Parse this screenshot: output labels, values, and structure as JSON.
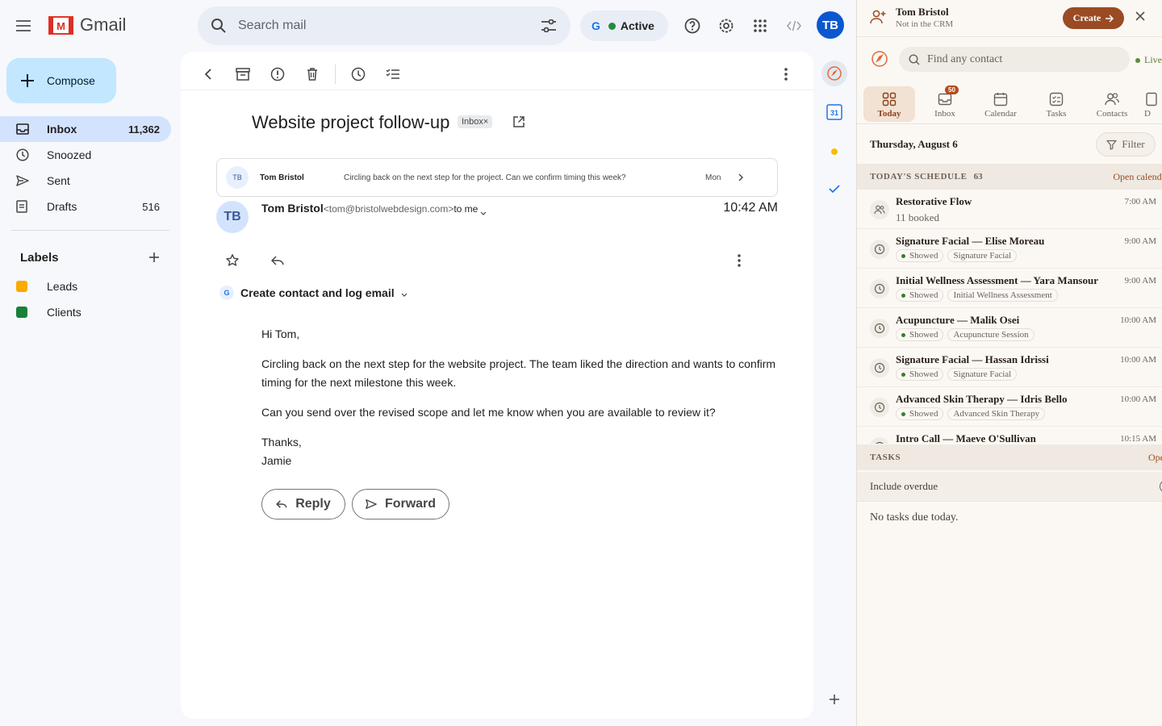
{
  "app": {
    "name": "Gmail"
  },
  "search": {
    "placeholder": "Search mail"
  },
  "status": {
    "g": "G",
    "label": "Active"
  },
  "account": {
    "initials": "TB"
  },
  "compose": {
    "label": "Compose"
  },
  "nav": [
    {
      "label": "Inbox",
      "count": "11,362",
      "icon": "inbox-icon"
    },
    {
      "label": "Snoozed",
      "count": "",
      "icon": "clock-icon"
    },
    {
      "label": "Sent",
      "count": "",
      "icon": "send-icon"
    },
    {
      "label": "Drafts",
      "count": "516",
      "icon": "draft-icon"
    }
  ],
  "labels": {
    "title": "Labels",
    "items": [
      {
        "name": "Leads",
        "color": "#f9ab00"
      },
      {
        "name": "Clients",
        "color": "#188038"
      }
    ]
  },
  "email": {
    "subject": "Website project follow-up",
    "chip": "Inbox×",
    "collapsed": {
      "initials": "TB",
      "from": "Tom Bristol",
      "snippet": "Circling back on the next step for the project. Can we confirm timing this week?",
      "date": "Mon"
    },
    "message": {
      "initials": "TB",
      "from_name": "Tom Bristol",
      "from_email": "<tom@bristolwebdesign.com>",
      "to": "to me",
      "time": "10:42 AM"
    },
    "crm_action": {
      "g": "G",
      "label": "Create contact and log email"
    },
    "body": {
      "greeting": "Hi Tom,",
      "p1": "Circling back on the next step for the website project. The team liked the direction and wants to confirm timing for the next milestone this week.",
      "p2": "Can you send over the revised scope and let me know when you are available to review it?",
      "signoff": "Thanks,",
      "signature": "Jamie"
    },
    "reply_label": "Reply",
    "forward_label": "Forward"
  },
  "rail": {
    "calendar_day": "31"
  },
  "crm": {
    "contact_name": "Tom Bristol",
    "contact_status": "Not in the CRM",
    "create_label": "Create",
    "search_placeholder": "Find any contact",
    "live_label": "Live",
    "tabs": [
      {
        "label": "Today",
        "active": true
      },
      {
        "label": "Inbox",
        "badge": "50"
      },
      {
        "label": "Calendar"
      },
      {
        "label": "Tasks"
      },
      {
        "label": "Contacts"
      },
      {
        "label": "D"
      }
    ],
    "date": "Thursday, August 6",
    "filter_label": "Filter",
    "schedule": {
      "title": "TODAY'S SCHEDULE",
      "count": "63",
      "open_label": "Open calendar",
      "items": [
        {
          "title": "Restorative Flow",
          "time": "7:00 AM",
          "sub": "11 booked",
          "icon": "group-icon"
        },
        {
          "title": "Signature Facial — Elise Moreau",
          "time": "9:00 AM",
          "status": "Showed",
          "service": "Signature Facial",
          "icon": "clock-icon"
        },
        {
          "title": "Initial Wellness Assessment — Yara Mansour",
          "time": "9:00 AM",
          "status": "Showed",
          "service": "Initial Wellness Assessment",
          "icon": "clock-icon"
        },
        {
          "title": "Acupuncture — Malik Osei",
          "time": "10:00 AM",
          "status": "Showed",
          "service": "Acupuncture Session",
          "icon": "clock-icon"
        },
        {
          "title": "Signature Facial — Hassan Idrissi",
          "time": "10:00 AM",
          "status": "Showed",
          "service": "Signature Facial",
          "icon": "clock-icon"
        },
        {
          "title": "Advanced Skin Therapy — Idris Bello",
          "time": "10:00 AM",
          "status": "Showed",
          "service": "Advanced Skin Therapy",
          "icon": "clock-icon"
        },
        {
          "title": "Intro Call — Maeve O'Sullivan",
          "time": "10:15 AM",
          "status": "",
          "service": "",
          "icon": "clock-icon"
        }
      ]
    },
    "tasks": {
      "title": "TASKS",
      "open_label": "Open",
      "overdue_label": "Include overdue",
      "empty": "No tasks due today."
    }
  }
}
